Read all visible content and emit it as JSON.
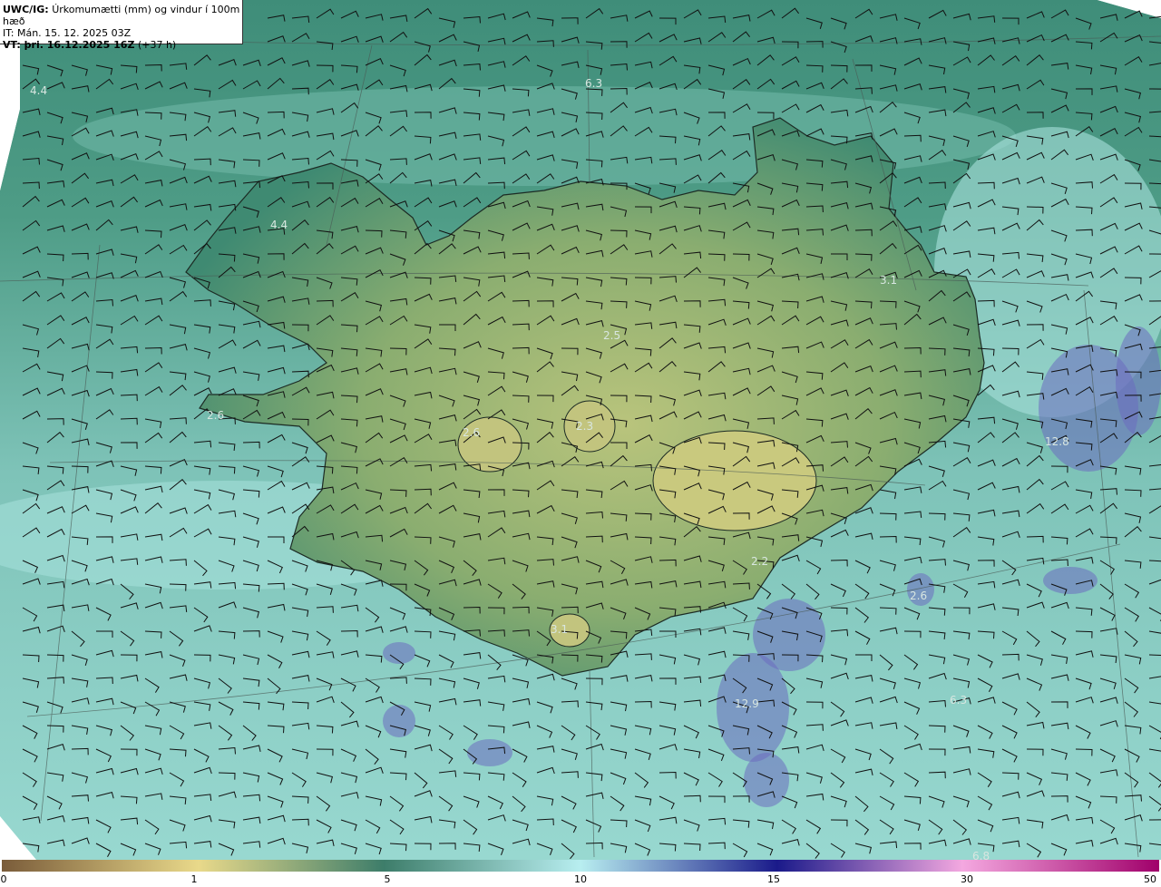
{
  "header": {
    "line1_prefix": "UWC/IG:",
    "line1_text": "Úrkomumætti (mm) og vindur í 100m hæð",
    "line2": "IT: Mán. 15. 12. 2025 03Z",
    "line3_prefix": "VT: þri. 16.12.2025 16Z",
    "line3_suffix": "(+37 h)"
  },
  "map": {
    "value_labels": [
      "4.4",
      "4.4",
      "6.3",
      "3.1",
      "2.5",
      "2.6",
      "2.6",
      "2.3",
      "12.8",
      "2.2",
      "2.6",
      "3.1",
      "12.9",
      "6.3",
      "6.8"
    ],
    "colors": {
      "ocean": "#8fd0c8",
      "land_low": "#3f8a74",
      "land_high": "#b9c57e",
      "heavy_precip": "#6c6cc0"
    }
  },
  "legend": {
    "ticks": [
      "0",
      "1",
      "5",
      "10",
      "15",
      "30",
      "50"
    ],
    "colors": [
      "#7a5c3a",
      "#e9d98a",
      "#3d7d6a",
      "#b8eef0",
      "#1a1a8a",
      "#f4a8e0",
      "#a0006a"
    ]
  }
}
